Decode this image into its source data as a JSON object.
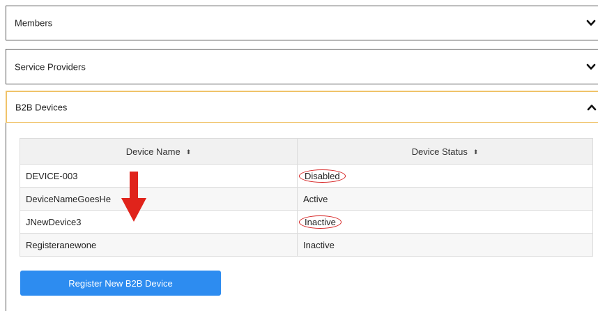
{
  "panels": {
    "members": {
      "title": "Members",
      "icon": "chevron-down-icon"
    },
    "service_providers": {
      "title": "Service Providers",
      "icon": "chevron-down-icon"
    },
    "b2b_devices": {
      "title": "B2B Devices",
      "icon": "chevron-up-icon",
      "expanded": true
    }
  },
  "table": {
    "columns": [
      {
        "label": "Device Name",
        "sort_icon": "sort-icon"
      },
      {
        "label": "Device Status",
        "sort_icon": "sort-icon"
      }
    ],
    "rows": [
      {
        "name": "DEVICE-003",
        "status": "Disabled",
        "highlighted": true
      },
      {
        "name": "DeviceNameGoesHe",
        "status": "Active",
        "highlighted": false
      },
      {
        "name": "JNewDevice3",
        "status": "Inactive",
        "highlighted": true
      },
      {
        "name": "Registeranewone",
        "status": "Inactive",
        "highlighted": false
      }
    ]
  },
  "register_button": {
    "label": "Register New B2B Device"
  },
  "colors": {
    "accent": "#2d8cf0",
    "expanded_border": "#f0c36a",
    "annotation_red": "#d62020"
  }
}
